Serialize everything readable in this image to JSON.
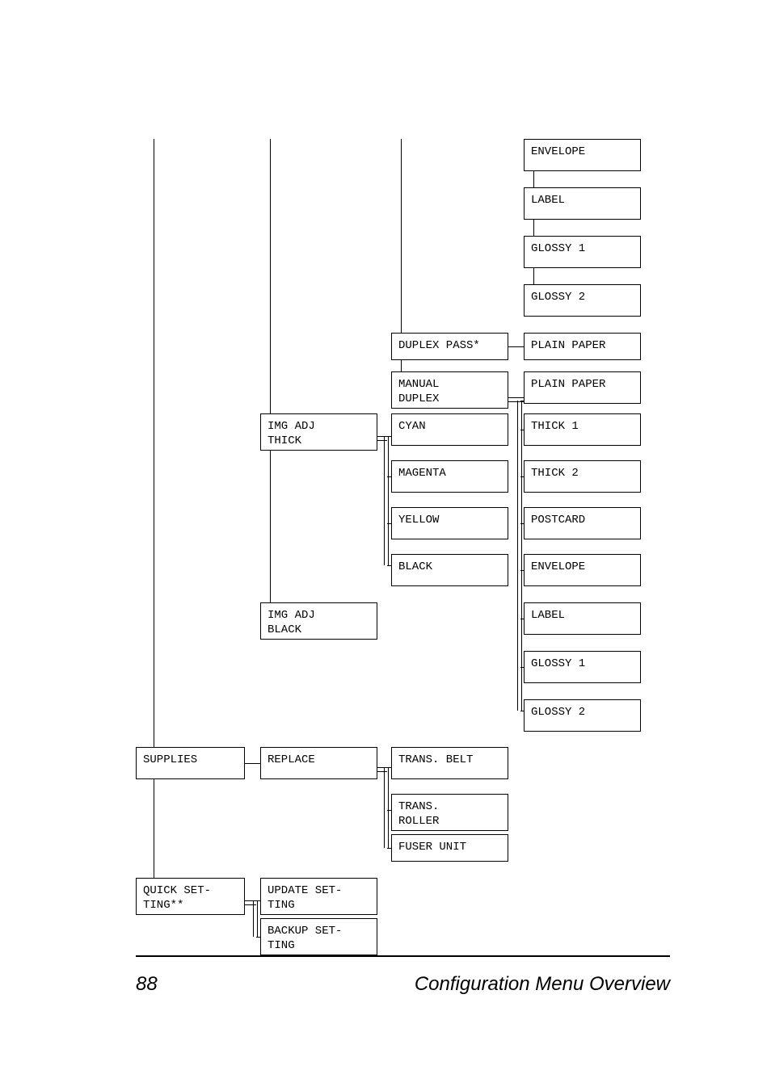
{
  "col1": {
    "supplies": "SUPPLIES",
    "quick_setting": "QUICK SET-\nTING**"
  },
  "col2": {
    "img_adj_thick": "IMG ADJ\nTHICK",
    "img_adj_black": "IMG ADJ\nBLACK",
    "replace": "REPLACE",
    "update_setting": "UPDATE SET-\nTING",
    "backup_setting": "BACKUP SET-\nTING"
  },
  "col3": {
    "duplex_pass": "DUPLEX PASS*",
    "manual_duplex": "MANUAL\nDUPLEX",
    "cyan": "CYAN",
    "magenta": "MAGENTA",
    "yellow": "YELLOW",
    "black": "BLACK",
    "trans_belt": "TRANS. BELT",
    "trans_roller": "TRANS.\nROLLER",
    "fuser_unit": "FUSER UNIT"
  },
  "col4": {
    "envelope": "ENVELOPE",
    "label": "LABEL",
    "glossy1": "GLOSSY 1",
    "glossy2": "GLOSSY 2",
    "plain_paper1": "PLAIN PAPER",
    "plain_paper2": "PLAIN PAPER",
    "thick1": "THICK 1",
    "thick2": "THICK 2",
    "postcard": "POSTCARD",
    "envelope2": "ENVELOPE",
    "label2": "LABEL",
    "glossy1b": "GLOSSY 1",
    "glossy2b": "GLOSSY 2"
  },
  "footer": {
    "page": "88",
    "title": "Configuration Menu Overview"
  }
}
